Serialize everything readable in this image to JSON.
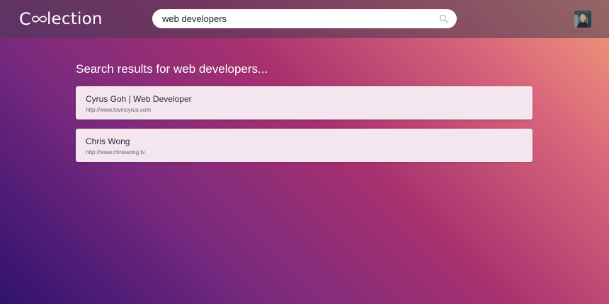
{
  "app": {
    "logo_prefix": "C",
    "logo_suffix": "lection",
    "logo_label": "Coolection"
  },
  "search": {
    "value": "web developers",
    "placeholder": "Search",
    "icon": "search-icon"
  },
  "user": {
    "avatar_icon": "avatar"
  },
  "results": {
    "heading": "Search results for web developers...",
    "items": [
      {
        "title": "Cyrus Goh | Web Developer",
        "url": "http://www.lovincyrus.com"
      },
      {
        "title": "Chris Wong",
        "url": "http://www.chriswong.tv"
      }
    ]
  },
  "colors": {
    "gradient_start": "#30126f",
    "gradient_mid": "#a7306f",
    "gradient_end": "#f29a7a",
    "card_background": "#f4e6ee"
  }
}
